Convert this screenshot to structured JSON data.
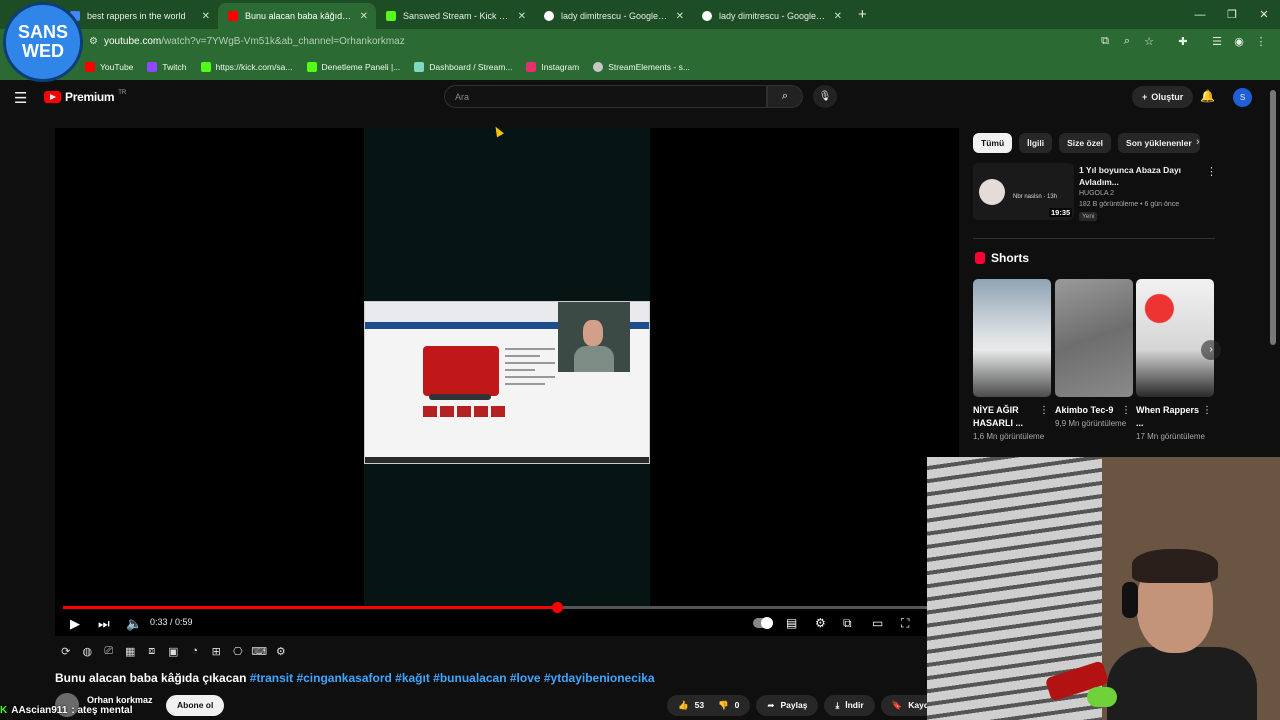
{
  "browser": {
    "tabs": [
      {
        "title": "best rappers in the world",
        "active": false,
        "favicon_color": "#4285f4"
      },
      {
        "title": "Bunu alacan baba kâğıda çıkacak",
        "active": true,
        "favicon_color": "#ff0000"
      },
      {
        "title": "Sanswed Stream - Kick Dashboard",
        "active": false,
        "favicon_color": "#53fc18"
      },
      {
        "title": "lady dimitrescu - Google'da Ara",
        "active": false,
        "favicon_color": "#ffffff"
      },
      {
        "title": "lady dimitrescu - Google'da Ara",
        "active": false,
        "favicon_color": "#ffffff"
      }
    ],
    "url_main": "youtube.com",
    "url_rest": "/watch?v=7YWgB-Vm51k&ab_channel=Orhankorkmaz",
    "bookmarks": [
      {
        "label": "YouTube",
        "color": "#ff0000"
      },
      {
        "label": "Twitch",
        "color": "#9146ff"
      },
      {
        "label": "https://kick.com/sa...",
        "color": "#53fc18"
      },
      {
        "label": "Denetleme Paneli |...",
        "color": "#53fc18"
      },
      {
        "label": "Dashboard / Stream...",
        "color": "#7fd6c2"
      },
      {
        "label": "Instagram",
        "color": "#e1306c"
      },
      {
        "label": "StreamElements - s...",
        "color": "#c7c7c7"
      }
    ]
  },
  "overlay_logo": {
    "line1": "SANS",
    "line2": "WED"
  },
  "youtube": {
    "logo_label": "Premium",
    "logo_region": "TR",
    "search_placeholder": "Ara",
    "create_label": "Oluştur",
    "avatar_initial": "S"
  },
  "player": {
    "time_display": "0:33 / 0:59",
    "progress_fraction": 0.57
  },
  "video": {
    "title": "Bunu alacan baba kâğıda çıkacan",
    "hashtags": "#transit #cingankasaford #kağıt #bunualacan #love #ytdayibenionecika",
    "channel": "Orhan korkmaz",
    "subscribe_label": "Abone ol",
    "likes": "53",
    "dislikes": "0",
    "share_label": "Paylaş",
    "download_label": "İndir",
    "save_label": "Kaydet"
  },
  "chat_overlay": {
    "user": "AAscian911",
    "message": ": ateş mental"
  },
  "sidebar": {
    "chips": [
      "Tümü",
      "İlgili",
      "Size özel",
      "Son yüklenenler"
    ],
    "recommendation": {
      "title": "1 Yıl boyunca Abaza Dayı Avladım...",
      "thumb_text": "Nbr naslsn · 13h",
      "channel": "HUGOLA 2",
      "meta": "182 B görüntüleme • 6 gün önce",
      "badge": "Yeni",
      "duration": "19:35"
    },
    "shorts_label": "Shorts",
    "shorts": [
      {
        "title": "NİYE AĞIR HASARLI ...",
        "views": "1,6 Mn görüntüleme",
        "bg": "#b9c2c8"
      },
      {
        "title": "Akimbo Tec-9",
        "views": "9,9 Mn görüntüleme",
        "bg": "#7d7d7d"
      },
      {
        "title": "When Rappers ...",
        "views": "17 Mn görüntüleme",
        "bg": "#e9e9e9"
      }
    ]
  }
}
